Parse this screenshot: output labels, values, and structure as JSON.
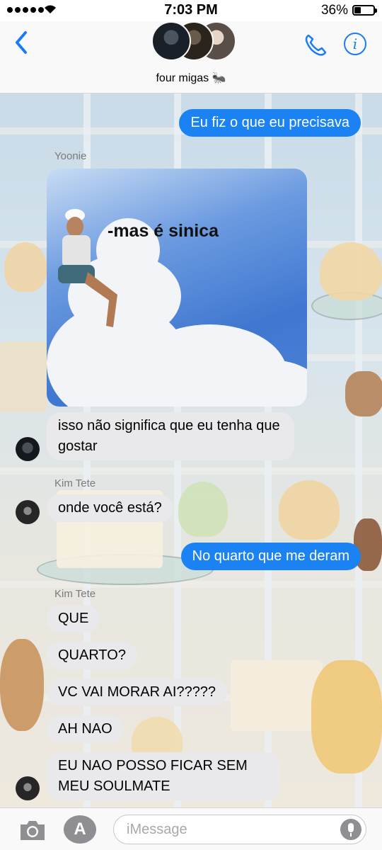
{
  "status": {
    "time": "7:03 PM",
    "battery": "36%",
    "battery_level": 0.36
  },
  "header": {
    "group_name": "four migas 🐜",
    "back_icon": "chevron-left-icon",
    "call_icon": "phone-icon",
    "info_icon": "info-icon",
    "info_glyph": "i",
    "accent": "#1a7cf5"
  },
  "messages": [
    {
      "type": "outgoing",
      "text": "Eu fiz o que eu precisava"
    },
    {
      "type": "incoming",
      "sender": "Yoonie",
      "image_caption": "-mas é sinica"
    },
    {
      "type": "incoming",
      "text": "isso não significa que eu tenha que gostar"
    },
    {
      "type": "incoming",
      "sender": "Kim Tete",
      "text": "onde você está?"
    },
    {
      "type": "outgoing",
      "text": "No quarto que me deram"
    },
    {
      "type": "incoming",
      "sender": "Kim Tete",
      "text": "QUE"
    },
    {
      "type": "incoming",
      "text": "QUARTO?"
    },
    {
      "type": "incoming",
      "text": "VC VAI MORAR AI?????"
    },
    {
      "type": "incoming",
      "text": "AH NAO"
    },
    {
      "type": "incoming",
      "text": "EU NAO POSSO FICAR SEM MEU SOULMATE"
    }
  ],
  "colors": {
    "outgoing_bubble": "#1b82f4",
    "incoming_bubble": "#e9e9eb"
  },
  "input": {
    "placeholder": "iMessage",
    "value": "",
    "camera_icon": "camera-icon",
    "apps_icon": "app-store-icon",
    "apps_glyph": "A",
    "mic_icon": "microphone-icon"
  }
}
